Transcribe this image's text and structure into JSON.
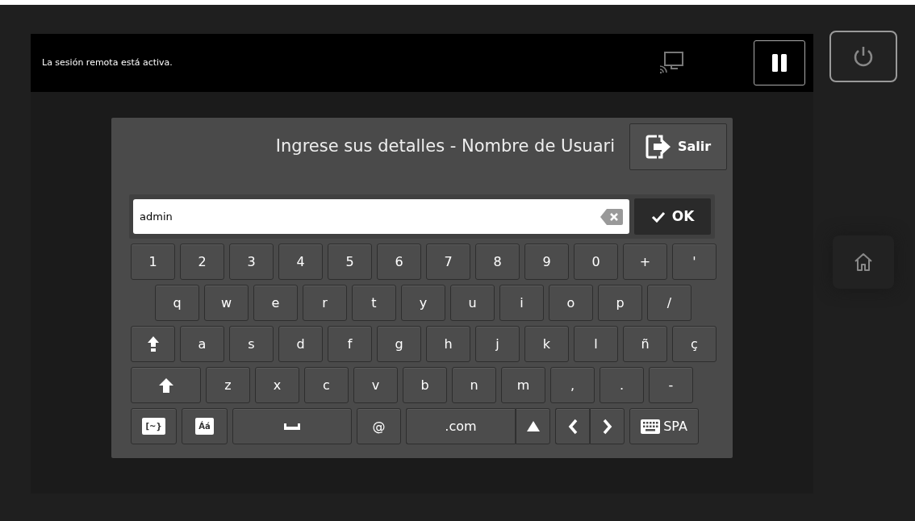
{
  "status_bar": {
    "message": "La sesión remota está activa."
  },
  "dialog": {
    "title": "Ingrese sus detalles - Nombre de Usuari",
    "exit_button": "Salir",
    "input": {
      "value": "admin"
    },
    "ok_button": "OK"
  },
  "keyboard": {
    "key_rows": [
      {
        "keys": [
          {
            "kind": "char",
            "label": "1"
          },
          {
            "kind": "char",
            "label": "2"
          },
          {
            "kind": "char",
            "label": "3"
          },
          {
            "kind": "char",
            "label": "4"
          },
          {
            "kind": "char",
            "label": "5"
          },
          {
            "kind": "char",
            "label": "6"
          },
          {
            "kind": "char",
            "label": "7"
          },
          {
            "kind": "char",
            "label": "8"
          },
          {
            "kind": "char",
            "label": "9"
          },
          {
            "kind": "char",
            "label": "0"
          },
          {
            "kind": "char",
            "label": "+"
          },
          {
            "kind": "char",
            "label": "'"
          }
        ]
      },
      {
        "keys": [
          {
            "kind": "char",
            "label": "q"
          },
          {
            "kind": "char",
            "label": "w"
          },
          {
            "kind": "char",
            "label": "e"
          },
          {
            "kind": "char",
            "label": "r"
          },
          {
            "kind": "char",
            "label": "t"
          },
          {
            "kind": "char",
            "label": "y"
          },
          {
            "kind": "char",
            "label": "u"
          },
          {
            "kind": "char",
            "label": "i"
          },
          {
            "kind": "char",
            "label": "o"
          },
          {
            "kind": "char",
            "label": "p"
          },
          {
            "kind": "char",
            "label": "/"
          }
        ]
      },
      {
        "keys": [
          {
            "kind": "caps"
          },
          {
            "kind": "char",
            "label": "a"
          },
          {
            "kind": "char",
            "label": "s"
          },
          {
            "kind": "char",
            "label": "d"
          },
          {
            "kind": "char",
            "label": "f"
          },
          {
            "kind": "char",
            "label": "g"
          },
          {
            "kind": "char",
            "label": "h"
          },
          {
            "kind": "char",
            "label": "j"
          },
          {
            "kind": "char",
            "label": "k"
          },
          {
            "kind": "char",
            "label": "l"
          },
          {
            "kind": "char",
            "label": "ñ"
          },
          {
            "kind": "char",
            "label": "ç"
          }
        ]
      },
      {
        "keys": [
          {
            "kind": "shift"
          },
          {
            "kind": "char",
            "label": "z"
          },
          {
            "kind": "char",
            "label": "x"
          },
          {
            "kind": "char",
            "label": "c"
          },
          {
            "kind": "char",
            "label": "v"
          },
          {
            "kind": "char",
            "label": "b"
          },
          {
            "kind": "char",
            "label": "n"
          },
          {
            "kind": "char",
            "label": "m"
          },
          {
            "kind": "char",
            "label": ","
          },
          {
            "kind": "char",
            "label": "."
          },
          {
            "kind": "char",
            "label": "-"
          }
        ]
      },
      {
        "keys": [
          {
            "kind": "badge",
            "label": "[~}"
          },
          {
            "kind": "badge",
            "label": "Áá"
          },
          {
            "kind": "space"
          },
          {
            "kind": "char",
            "label": "@"
          },
          {
            "kind": "dotcom",
            "label": ".com"
          },
          {
            "kind": "up"
          },
          {
            "kind": "left"
          },
          {
            "kind": "right"
          },
          {
            "kind": "language",
            "label": "SPA"
          }
        ]
      }
    ]
  }
}
